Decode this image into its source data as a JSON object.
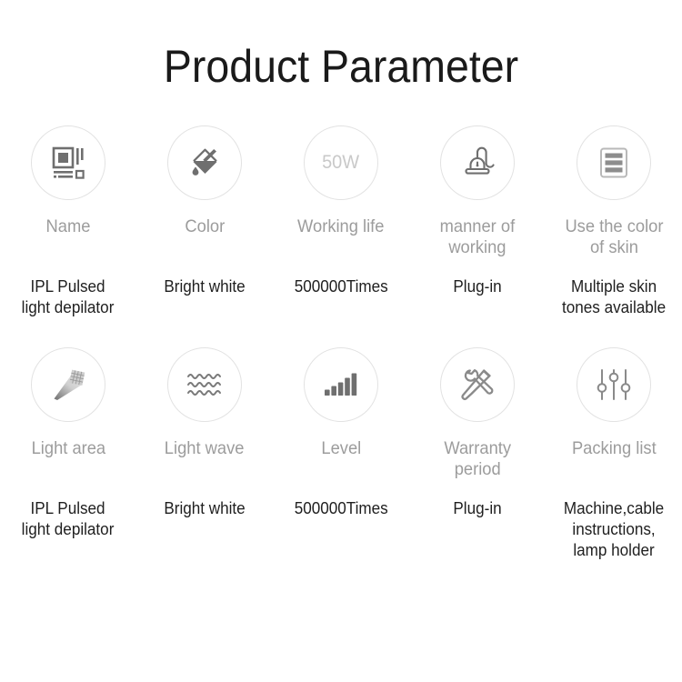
{
  "page": {
    "title": "Product Parameter",
    "background_color": "#ffffff",
    "label_color": "#9c9c9c",
    "value_color": "#1f1f1f",
    "circle_border_color": "#e2e2e2",
    "icon_color": "#6f6f6f"
  },
  "rows": [
    {
      "items": [
        {
          "icon": "layout-blocks-icon",
          "label": "Name",
          "value": "IPL Pulsed\nlight depilator"
        },
        {
          "icon": "paint-bucket-icon",
          "label": "Color",
          "value": "Bright white"
        },
        {
          "icon": "wattage-50w-icon",
          "icon_text": "50W",
          "label": "Working life",
          "value": "500000Times"
        },
        {
          "icon": "power-plug-icon",
          "label": "manner of\nworking",
          "value": "Plug-in"
        },
        {
          "icon": "stacked-bars-list-icon",
          "label": "Use the color\nof skin",
          "value": "Multiple skin\ntones available"
        }
      ]
    },
    {
      "items": [
        {
          "icon": "light-beam-grid-icon",
          "label": "Light area",
          "value": "IPL Pulsed\nlight depilator"
        },
        {
          "icon": "wave-lines-icon",
          "label": "Light wave",
          "value": "Bright white"
        },
        {
          "icon": "signal-bars-icon",
          "label": "Level",
          "value": "500000Times"
        },
        {
          "icon": "wrench-screwdriver-icon",
          "label": "Warranty\nperiod",
          "value": "Plug-in"
        },
        {
          "icon": "sliders-icon",
          "label": "Packing list",
          "value": "Machine,cable\ninstructions,\nlamp holder"
        }
      ]
    }
  ]
}
